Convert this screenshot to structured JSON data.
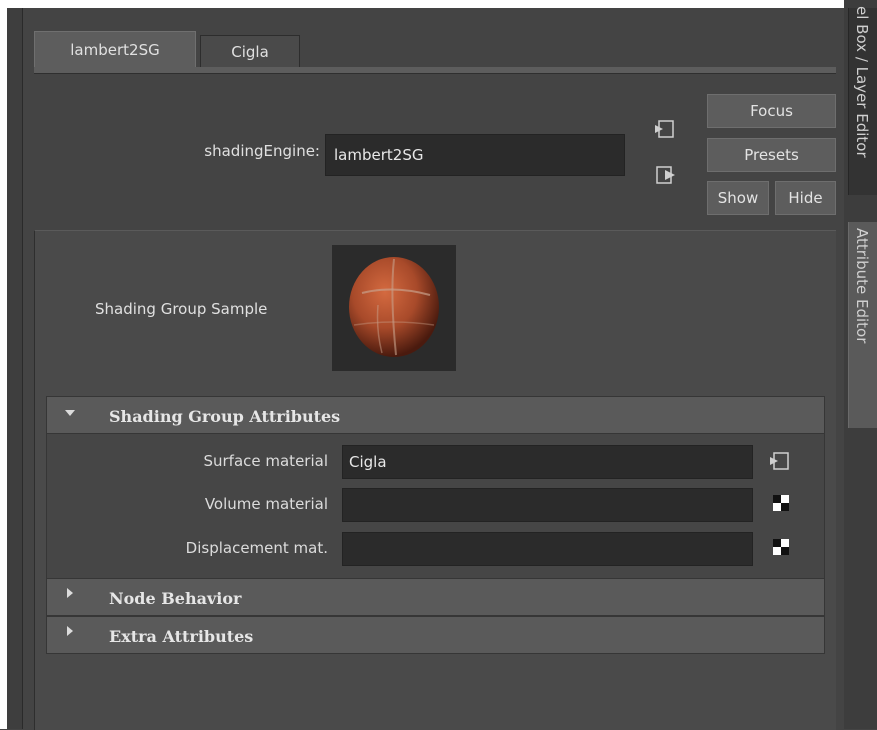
{
  "tabs": [
    {
      "label": "lambert2SG",
      "active": true
    },
    {
      "label": "Cigla",
      "active": false
    }
  ],
  "header": {
    "shading_engine_label": "shadingEngine:",
    "shading_engine_value": "lambert2SG",
    "focus_label": "Focus",
    "presets_label": "Presets",
    "show_label": "Show",
    "hide_label": "Hide"
  },
  "sample": {
    "label": "Shading Group Sample"
  },
  "sections": {
    "shading_group_attributes": "Shading Group Attributes",
    "node_behavior": "Node Behavior",
    "extra_attributes": "Extra Attributes"
  },
  "attributes": [
    {
      "label": "Surface material",
      "value": "Cigla",
      "icon": "input-connection-icon"
    },
    {
      "label": "Volume material",
      "value": "",
      "icon": "checker-map-icon"
    },
    {
      "label": "Displacement mat.",
      "value": "",
      "icon": "checker-map-icon"
    }
  ],
  "side_tabs": {
    "channel_box": "el Box / Layer Editor",
    "attribute_editor": "Attribute Editor"
  },
  "colors": {
    "panel": "#444444",
    "field": "#2b2b2b",
    "section_header": "#5a5a5a",
    "sphere": "#a84a2a"
  }
}
